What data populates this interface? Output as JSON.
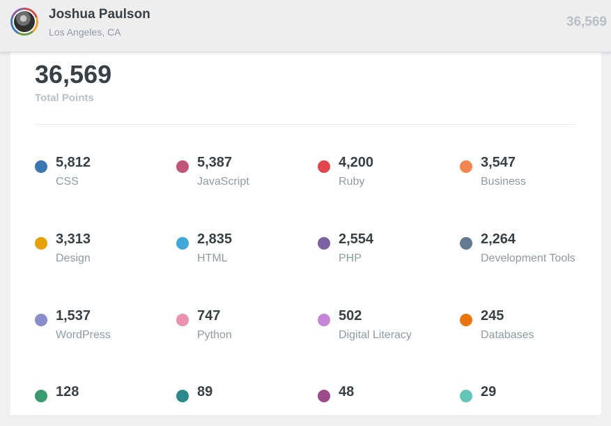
{
  "header": {
    "name": "Joshua Paulson",
    "location": "Los Angeles, CA",
    "points": "36,569"
  },
  "summary": {
    "total": "36,569",
    "label": "Total Points"
  },
  "topics": [
    {
      "points": "5,812",
      "name": "CSS",
      "color": "#3a76b1"
    },
    {
      "points": "5,387",
      "name": "JavaScript",
      "color": "#c25575"
    },
    {
      "points": "4,200",
      "name": "Ruby",
      "color": "#e0474c"
    },
    {
      "points": "3,547",
      "name": "Business",
      "color": "#f4844e"
    },
    {
      "points": "3,313",
      "name": "Design",
      "color": "#e6a00c"
    },
    {
      "points": "2,835",
      "name": "HTML",
      "color": "#40a8d8"
    },
    {
      "points": "2,554",
      "name": "PHP",
      "color": "#7b62a3"
    },
    {
      "points": "2,264",
      "name": "Development Tools",
      "color": "#637a91"
    },
    {
      "points": "1,537",
      "name": "WordPress",
      "color": "#8a8ccb"
    },
    {
      "points": "747",
      "name": "Python",
      "color": "#ec91ae"
    },
    {
      "points": "502",
      "name": "Digital Literacy",
      "color": "#c585d6"
    },
    {
      "points": "245",
      "name": "Databases",
      "color": "#e87510"
    },
    {
      "points": "128",
      "name": "",
      "color": "#3a9a6f"
    },
    {
      "points": "89",
      "name": "",
      "color": "#2a8a8a"
    },
    {
      "points": "48",
      "name": "",
      "color": "#9c4a8c"
    },
    {
      "points": "29",
      "name": "",
      "color": "#5fc6b8"
    }
  ]
}
